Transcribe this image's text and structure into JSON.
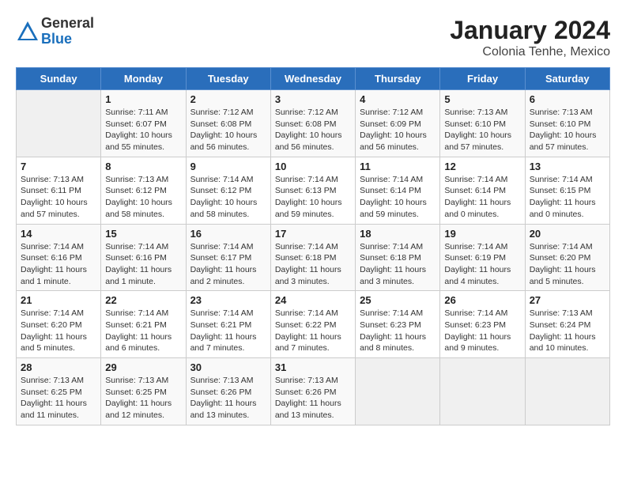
{
  "logo": {
    "general": "General",
    "blue": "Blue"
  },
  "title": "January 2024",
  "location": "Colonia Tenhe, Mexico",
  "weekdays": [
    "Sunday",
    "Monday",
    "Tuesday",
    "Wednesday",
    "Thursday",
    "Friday",
    "Saturday"
  ],
  "weeks": [
    [
      {
        "day": "",
        "sunrise": "",
        "sunset": "",
        "daylight": ""
      },
      {
        "day": "1",
        "sunrise": "Sunrise: 7:11 AM",
        "sunset": "Sunset: 6:07 PM",
        "daylight": "Daylight: 10 hours and 55 minutes."
      },
      {
        "day": "2",
        "sunrise": "Sunrise: 7:12 AM",
        "sunset": "Sunset: 6:08 PM",
        "daylight": "Daylight: 10 hours and 56 minutes."
      },
      {
        "day": "3",
        "sunrise": "Sunrise: 7:12 AM",
        "sunset": "Sunset: 6:08 PM",
        "daylight": "Daylight: 10 hours and 56 minutes."
      },
      {
        "day": "4",
        "sunrise": "Sunrise: 7:12 AM",
        "sunset": "Sunset: 6:09 PM",
        "daylight": "Daylight: 10 hours and 56 minutes."
      },
      {
        "day": "5",
        "sunrise": "Sunrise: 7:13 AM",
        "sunset": "Sunset: 6:10 PM",
        "daylight": "Daylight: 10 hours and 57 minutes."
      },
      {
        "day": "6",
        "sunrise": "Sunrise: 7:13 AM",
        "sunset": "Sunset: 6:10 PM",
        "daylight": "Daylight: 10 hours and 57 minutes."
      }
    ],
    [
      {
        "day": "7",
        "sunrise": "Sunrise: 7:13 AM",
        "sunset": "Sunset: 6:11 PM",
        "daylight": "Daylight: 10 hours and 57 minutes."
      },
      {
        "day": "8",
        "sunrise": "Sunrise: 7:13 AM",
        "sunset": "Sunset: 6:12 PM",
        "daylight": "Daylight: 10 hours and 58 minutes."
      },
      {
        "day": "9",
        "sunrise": "Sunrise: 7:14 AM",
        "sunset": "Sunset: 6:12 PM",
        "daylight": "Daylight: 10 hours and 58 minutes."
      },
      {
        "day": "10",
        "sunrise": "Sunrise: 7:14 AM",
        "sunset": "Sunset: 6:13 PM",
        "daylight": "Daylight: 10 hours and 59 minutes."
      },
      {
        "day": "11",
        "sunrise": "Sunrise: 7:14 AM",
        "sunset": "Sunset: 6:14 PM",
        "daylight": "Daylight: 10 hours and 59 minutes."
      },
      {
        "day": "12",
        "sunrise": "Sunrise: 7:14 AM",
        "sunset": "Sunset: 6:14 PM",
        "daylight": "Daylight: 11 hours and 0 minutes."
      },
      {
        "day": "13",
        "sunrise": "Sunrise: 7:14 AM",
        "sunset": "Sunset: 6:15 PM",
        "daylight": "Daylight: 11 hours and 0 minutes."
      }
    ],
    [
      {
        "day": "14",
        "sunrise": "Sunrise: 7:14 AM",
        "sunset": "Sunset: 6:16 PM",
        "daylight": "Daylight: 11 hours and 1 minute."
      },
      {
        "day": "15",
        "sunrise": "Sunrise: 7:14 AM",
        "sunset": "Sunset: 6:16 PM",
        "daylight": "Daylight: 11 hours and 1 minute."
      },
      {
        "day": "16",
        "sunrise": "Sunrise: 7:14 AM",
        "sunset": "Sunset: 6:17 PM",
        "daylight": "Daylight: 11 hours and 2 minutes."
      },
      {
        "day": "17",
        "sunrise": "Sunrise: 7:14 AM",
        "sunset": "Sunset: 6:18 PM",
        "daylight": "Daylight: 11 hours and 3 minutes."
      },
      {
        "day": "18",
        "sunrise": "Sunrise: 7:14 AM",
        "sunset": "Sunset: 6:18 PM",
        "daylight": "Daylight: 11 hours and 3 minutes."
      },
      {
        "day": "19",
        "sunrise": "Sunrise: 7:14 AM",
        "sunset": "Sunset: 6:19 PM",
        "daylight": "Daylight: 11 hours and 4 minutes."
      },
      {
        "day": "20",
        "sunrise": "Sunrise: 7:14 AM",
        "sunset": "Sunset: 6:20 PM",
        "daylight": "Daylight: 11 hours and 5 minutes."
      }
    ],
    [
      {
        "day": "21",
        "sunrise": "Sunrise: 7:14 AM",
        "sunset": "Sunset: 6:20 PM",
        "daylight": "Daylight: 11 hours and 5 minutes."
      },
      {
        "day": "22",
        "sunrise": "Sunrise: 7:14 AM",
        "sunset": "Sunset: 6:21 PM",
        "daylight": "Daylight: 11 hours and 6 minutes."
      },
      {
        "day": "23",
        "sunrise": "Sunrise: 7:14 AM",
        "sunset": "Sunset: 6:21 PM",
        "daylight": "Daylight: 11 hours and 7 minutes."
      },
      {
        "day": "24",
        "sunrise": "Sunrise: 7:14 AM",
        "sunset": "Sunset: 6:22 PM",
        "daylight": "Daylight: 11 hours and 7 minutes."
      },
      {
        "day": "25",
        "sunrise": "Sunrise: 7:14 AM",
        "sunset": "Sunset: 6:23 PM",
        "daylight": "Daylight: 11 hours and 8 minutes."
      },
      {
        "day": "26",
        "sunrise": "Sunrise: 7:14 AM",
        "sunset": "Sunset: 6:23 PM",
        "daylight": "Daylight: 11 hours and 9 minutes."
      },
      {
        "day": "27",
        "sunrise": "Sunrise: 7:13 AM",
        "sunset": "Sunset: 6:24 PM",
        "daylight": "Daylight: 11 hours and 10 minutes."
      }
    ],
    [
      {
        "day": "28",
        "sunrise": "Sunrise: 7:13 AM",
        "sunset": "Sunset: 6:25 PM",
        "daylight": "Daylight: 11 hours and 11 minutes."
      },
      {
        "day": "29",
        "sunrise": "Sunrise: 7:13 AM",
        "sunset": "Sunset: 6:25 PM",
        "daylight": "Daylight: 11 hours and 12 minutes."
      },
      {
        "day": "30",
        "sunrise": "Sunrise: 7:13 AM",
        "sunset": "Sunset: 6:26 PM",
        "daylight": "Daylight: 11 hours and 13 minutes."
      },
      {
        "day": "31",
        "sunrise": "Sunrise: 7:13 AM",
        "sunset": "Sunset: 6:26 PM",
        "daylight": "Daylight: 11 hours and 13 minutes."
      },
      {
        "day": "",
        "sunrise": "",
        "sunset": "",
        "daylight": ""
      },
      {
        "day": "",
        "sunrise": "",
        "sunset": "",
        "daylight": ""
      },
      {
        "day": "",
        "sunrise": "",
        "sunset": "",
        "daylight": ""
      }
    ]
  ]
}
